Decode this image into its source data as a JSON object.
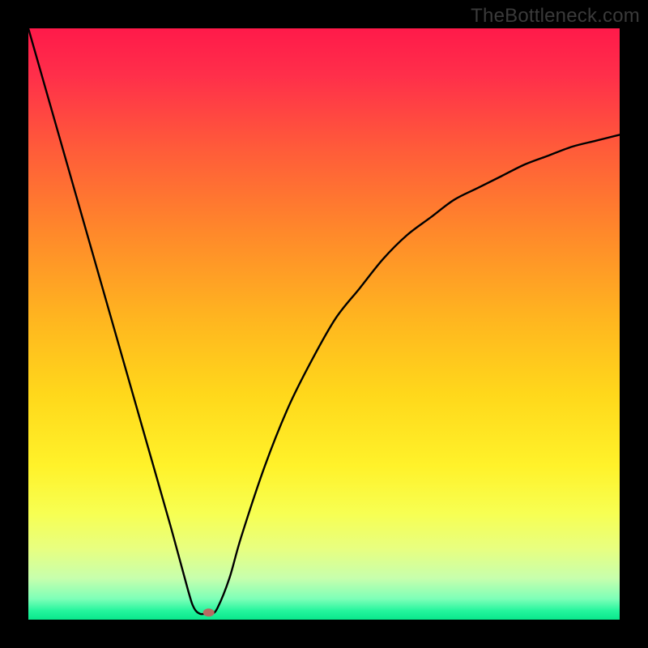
{
  "watermark": "TheBottleneck.com",
  "chart_data": {
    "type": "line",
    "title": "",
    "xlabel": "",
    "ylabel": "",
    "xlim": [
      0,
      100
    ],
    "ylim": [
      0,
      100
    ],
    "curve": [
      {
        "x": 0,
        "y": 100
      },
      {
        "x": 4,
        "y": 86
      },
      {
        "x": 8,
        "y": 72
      },
      {
        "x": 12,
        "y": 58
      },
      {
        "x": 16,
        "y": 44
      },
      {
        "x": 20,
        "y": 30
      },
      {
        "x": 24,
        "y": 16
      },
      {
        "x": 27,
        "y": 5
      },
      {
        "x": 28,
        "y": 2
      },
      {
        "x": 29,
        "y": 1
      },
      {
        "x": 30,
        "y": 1
      },
      {
        "x": 31,
        "y": 1
      },
      {
        "x": 32,
        "y": 2
      },
      {
        "x": 34,
        "y": 7
      },
      {
        "x": 36,
        "y": 14
      },
      {
        "x": 40,
        "y": 26
      },
      {
        "x": 44,
        "y": 36
      },
      {
        "x": 48,
        "y": 44
      },
      {
        "x": 52,
        "y": 51
      },
      {
        "x": 56,
        "y": 56
      },
      {
        "x": 60,
        "y": 61
      },
      {
        "x": 64,
        "y": 65
      },
      {
        "x": 68,
        "y": 68
      },
      {
        "x": 72,
        "y": 71
      },
      {
        "x": 76,
        "y": 73
      },
      {
        "x": 80,
        "y": 75
      },
      {
        "x": 84,
        "y": 77
      },
      {
        "x": 88,
        "y": 78.5
      },
      {
        "x": 92,
        "y": 80
      },
      {
        "x": 96,
        "y": 81
      },
      {
        "x": 100,
        "y": 82
      }
    ],
    "marker": {
      "x": 30.5,
      "y": 1.2,
      "color": "#b86a62"
    },
    "gradient": {
      "stops": [
        {
          "offset": 0.0,
          "color": "#ff1a4a"
        },
        {
          "offset": 0.08,
          "color": "#ff2f4a"
        },
        {
          "offset": 0.2,
          "color": "#ff5a3a"
        },
        {
          "offset": 0.35,
          "color": "#ff8a2a"
        },
        {
          "offset": 0.5,
          "color": "#ffb81f"
        },
        {
          "offset": 0.62,
          "color": "#ffd81b"
        },
        {
          "offset": 0.74,
          "color": "#fff22a"
        },
        {
          "offset": 0.82,
          "color": "#f7ff52"
        },
        {
          "offset": 0.88,
          "color": "#e8ff80"
        },
        {
          "offset": 0.93,
          "color": "#c7ffad"
        },
        {
          "offset": 0.965,
          "color": "#7dffb8"
        },
        {
          "offset": 0.985,
          "color": "#24f59d"
        },
        {
          "offset": 1.0,
          "color": "#09e78c"
        }
      ]
    }
  }
}
